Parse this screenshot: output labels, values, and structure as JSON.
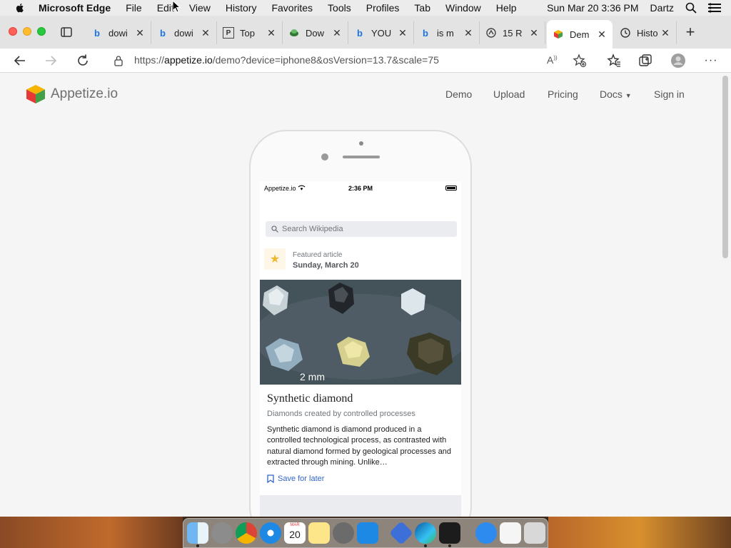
{
  "menubar": {
    "app_name": "Microsoft Edge",
    "items": [
      "File",
      "Edit",
      "View",
      "History",
      "Favorites",
      "Tools",
      "Profiles",
      "Tab",
      "Window",
      "Help"
    ],
    "clock": "Sun Mar 20  3:36 PM",
    "user": "Dartz"
  },
  "tabs": [
    {
      "title": "dowi",
      "icon": "bing-icon"
    },
    {
      "title": "dowi",
      "icon": "bing-icon"
    },
    {
      "title": "Top",
      "icon": "page-p-icon"
    },
    {
      "title": "Dow",
      "icon": "green-app-icon"
    },
    {
      "title": "YOU",
      "icon": "bing-icon"
    },
    {
      "title": "is m",
      "icon": "bing-icon"
    },
    {
      "title": "15 R",
      "icon": "site-icon"
    },
    {
      "title": "Dem",
      "icon": "appetize-cube-icon"
    },
    {
      "title": "Histo",
      "icon": "history-icon"
    }
  ],
  "address": {
    "url_prefix": "https://",
    "url_domain": "appetize.io",
    "url_path": "/demo?device=iphone8&osVersion=13.7&scale=75"
  },
  "site": {
    "logo_text": "Appetize.io",
    "nav": {
      "demo": "Demo",
      "upload": "Upload",
      "pricing": "Pricing",
      "docs": "Docs",
      "signin": "Sign in"
    }
  },
  "phone": {
    "status": {
      "carrier": "Appetize.io",
      "time": "2:36 PM"
    },
    "search_placeholder": "Search Wikipedia",
    "featured": {
      "kicker": "Featured article",
      "date": "Sunday, March 20"
    },
    "image_caption": "2 mm",
    "article": {
      "title": "Synthetic diamond",
      "subtitle": "Diamonds created by controlled processes",
      "body": "Synthetic diamond is diamond produced in a controlled technological process, as contrasted with natural diamond formed by geological processes and extracted through mining. Unlike…",
      "save_label": "Save for later"
    }
  },
  "dock": {
    "apps": [
      "finder-icon",
      "launchpad-icon",
      "chrome-icon",
      "safari-icon",
      "calendar-icon",
      "notes-icon",
      "system-preferences-icon",
      "app-store-icon",
      "blue-diamond-app-icon",
      "edge-icon",
      "terminal-icon",
      "app-store-alt-icon",
      "textedit-icon",
      "trash-icon"
    ],
    "calendar_day": "20",
    "calendar_month": "MAR"
  }
}
